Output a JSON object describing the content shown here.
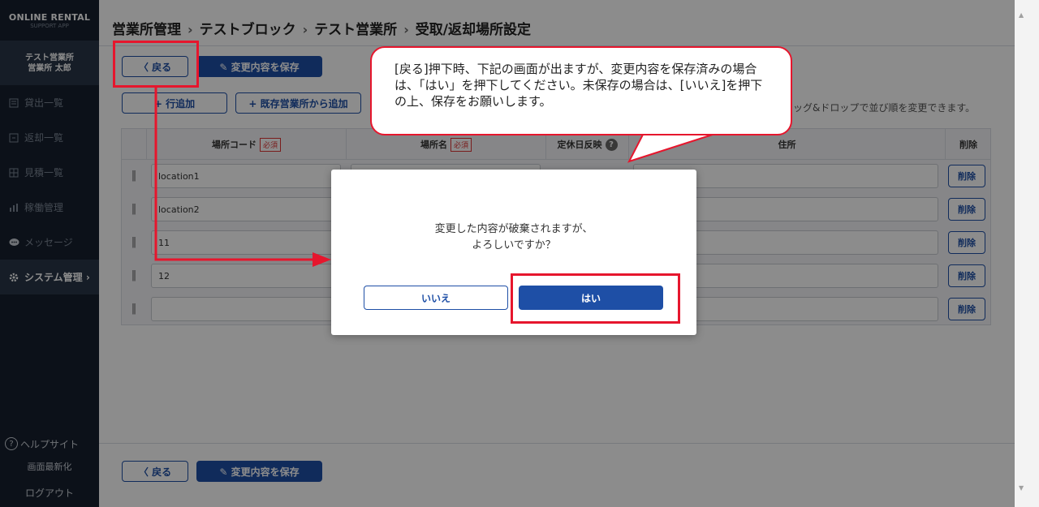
{
  "sidebar": {
    "brand_line1": "ONLINE RENTAL",
    "brand_line2": "SUPPORT APP",
    "user_line1": "テスト営業所",
    "user_line2": "営業所 太郎",
    "items": [
      {
        "label": "貸出一覧",
        "icon": "list-icon"
      },
      {
        "label": "返却一覧",
        "icon": "return-icon"
      },
      {
        "label": "見積一覧",
        "icon": "estimate-icon"
      },
      {
        "label": "稼働管理",
        "icon": "chart-icon"
      },
      {
        "label": "メッセージ",
        "icon": "chat-icon"
      },
      {
        "label": "システム管理 ›",
        "icon": "gear-icon"
      }
    ],
    "help": "ヘルプサイト",
    "refresh": "画面最新化",
    "logout": "ログアウト"
  },
  "breadcrumb": {
    "items": [
      "営業所管理",
      "テストブロック",
      "テスト営業所",
      "受取/返却場所設定"
    ],
    "sep": "›"
  },
  "toolbar": {
    "back_label": "〈 戻る",
    "save_label": "✎ 変更内容を保存",
    "add_row_label": "+ 行追加",
    "add_existing_label": "+ 既存営業所から追加",
    "hint": "ッグ&ドロップで並び順を変更できます。"
  },
  "table": {
    "headers": {
      "code": "場所コード",
      "name": "場所名",
      "holiday": "定休日反映",
      "address": "住所",
      "delete": "削除"
    },
    "required_label": "必須",
    "help_mark": "?",
    "rows": [
      {
        "code": "location1"
      },
      {
        "code": "location2"
      },
      {
        "code": "11"
      },
      {
        "code": "12"
      },
      {
        "code": ""
      }
    ],
    "delete_label": "削除"
  },
  "modal": {
    "line1": "変更した内容が破棄されますが、",
    "line2": "よろしいですか？",
    "no_label": "いいえ",
    "yes_label": "はい"
  },
  "callout": {
    "text": "[戻る]押下時、下記の画面が出ますが、変更内容を保存済みの場合は、「はい」を押下してください。未保存の場合は、[いいえ]を押下の上、保存をお願いします。"
  },
  "colors": {
    "primary": "#1e4fa6",
    "annotation": "#e6162d",
    "sidebar_bg": "#16202e"
  }
}
